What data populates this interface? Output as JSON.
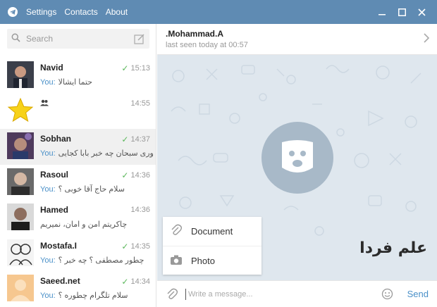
{
  "titlebar": {
    "menu": [
      "Settings",
      "Contacts",
      "About"
    ]
  },
  "search": {
    "placeholder": "Search"
  },
  "chats": [
    {
      "name": "Navid",
      "time": "15:13",
      "read": true,
      "you": "You:",
      "text": "حتما ایشالا",
      "avatar": "photo-dark"
    },
    {
      "name": "",
      "time": "14:55",
      "read": false,
      "you": "",
      "text": "",
      "avatar": "star",
      "group": true
    },
    {
      "name": "Sobhan",
      "time": "14:37",
      "read": true,
      "you": "You:",
      "text": "چطوری سبحان چه خبر بابا کجایی",
      "avatar": "photo-purple",
      "active": true
    },
    {
      "name": "Rasoul",
      "time": "14:36",
      "read": true,
      "you": "You:",
      "text": "سلام حاج آقا خوبی ؟",
      "avatar": "photo-gray"
    },
    {
      "name": "Hamed",
      "time": "14:36",
      "read": false,
      "you": "",
      "text": "چاکریتم امن و امان، نمیریم",
      "avatar": "photo-dark2"
    },
    {
      "name": "Mostafa.I",
      "time": "14:35",
      "read": true,
      "you": "You:",
      "text": "چطور مصطفی ؟ چه خبر ؟",
      "avatar": "sketch"
    },
    {
      "name": "Saeed.net",
      "time": "14:34",
      "read": true,
      "you": "You:",
      "text": "سلام تلگرام چطوره ؟",
      "avatar": "placeholder"
    }
  ],
  "header": {
    "peer_name": ".Mohammad.A",
    "status": "last seen today at 00:57"
  },
  "attach_menu": {
    "document": "Document",
    "photo": "Photo"
  },
  "watermark": "علم فردا",
  "composer": {
    "placeholder": "Write a message...",
    "send": "Send"
  },
  "colors": {
    "titlebar": "#5f8bb3",
    "accent": "#4a90c8",
    "chat_bg": "#dfe7ee",
    "check": "#5cb85c"
  },
  "icons": {
    "logo": "telegram-logo",
    "search": "search-icon",
    "compose": "compose-icon",
    "chevron": "chevron-right-icon",
    "attach": "paperclip-icon",
    "camera": "camera-icon",
    "emoji": "smiley-icon"
  }
}
